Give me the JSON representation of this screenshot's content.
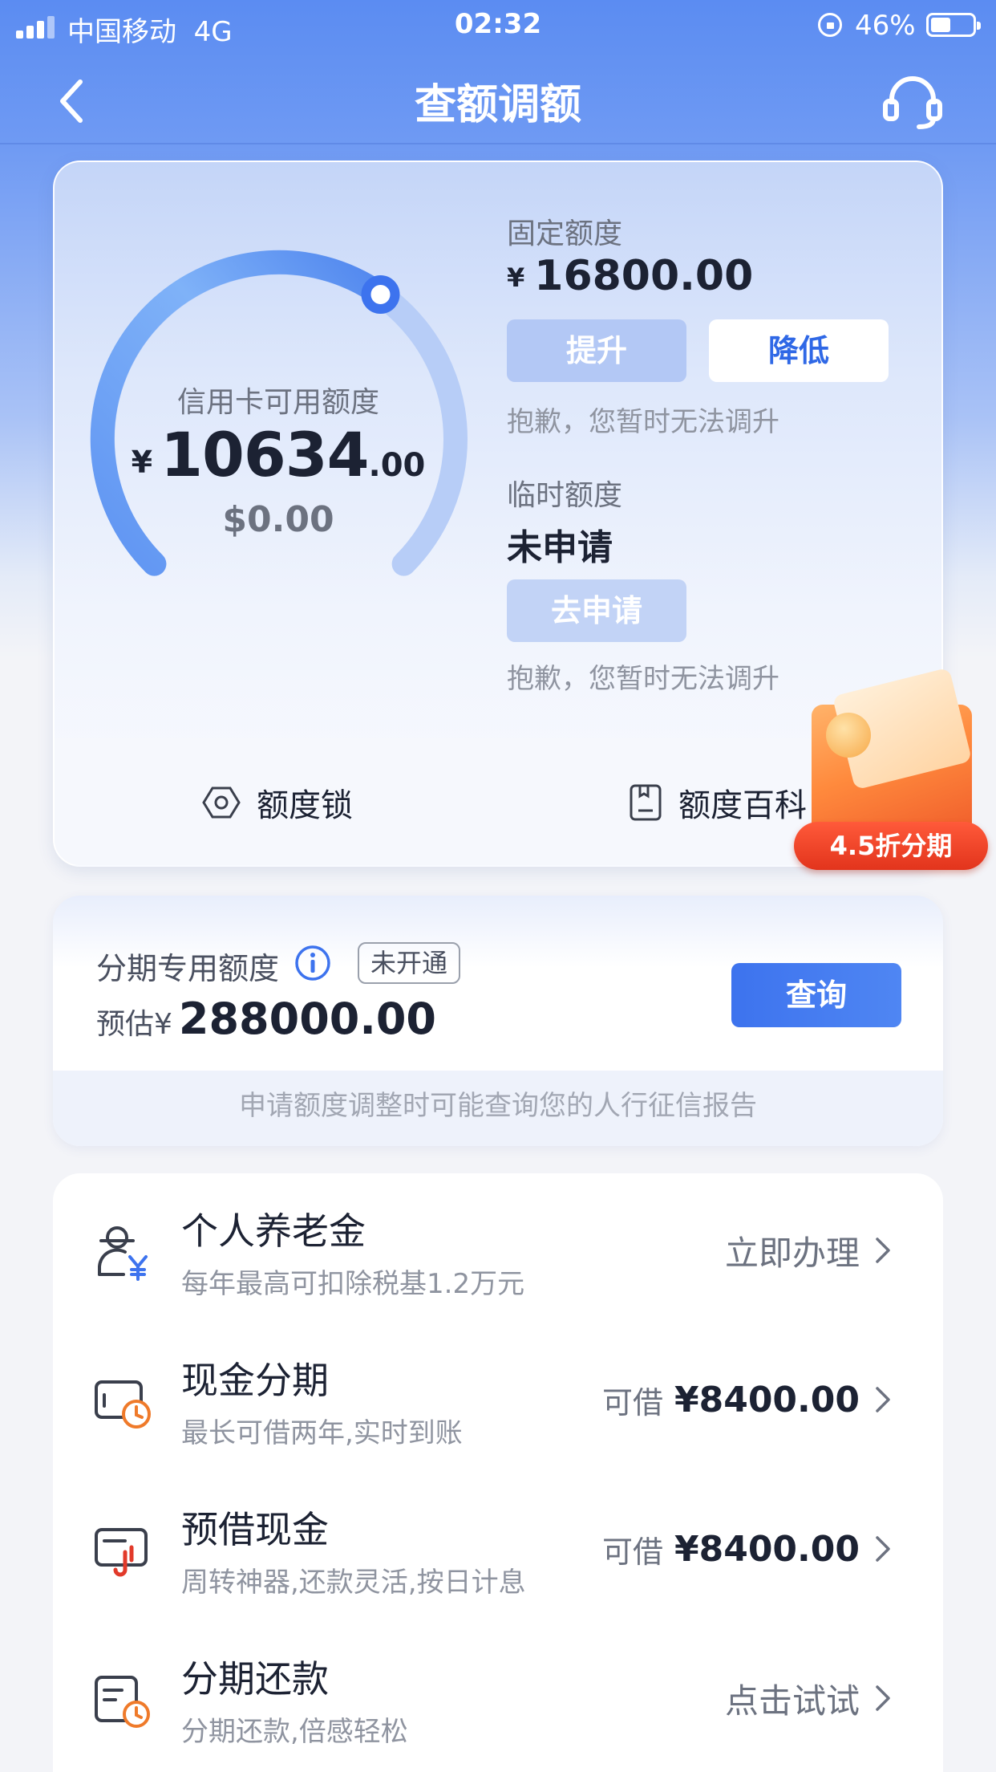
{
  "status_bar": {
    "carrier": "中国移动",
    "network": "4G",
    "time": "02:32",
    "battery": "46%"
  },
  "nav": {
    "title": "查额调额"
  },
  "credit": {
    "gauge_label": "信用卡可用额度",
    "currency": "¥",
    "available_int": "10634",
    "available_dec": ".00",
    "usd": "$0.00",
    "gauge_fraction": 0.63,
    "fixed_title": "固定额度",
    "fixed_amount": "16800.00",
    "raise_label": "提升",
    "lower_label": "降低",
    "fixed_note": "抱歉，您暂时无法调升",
    "temp_title": "临时额度",
    "temp_status": "未申请",
    "apply_label": "去申请",
    "temp_note": "抱歉，您暂时无法调升",
    "quota_lock_label": "额度锁",
    "quota_wiki_label": "额度百科"
  },
  "promo": {
    "label": "4.5折分期"
  },
  "installment": {
    "title": "分期专用额度",
    "badge": "未开通",
    "prefix": "预估¥",
    "amount": "288000.00",
    "query_label": "查询",
    "footer_note": "申请额度调整时可能查询您的人行征信报告"
  },
  "services": [
    {
      "icon": "pension-icon",
      "title": "个人养老金",
      "subtitle": "每年最高可扣除税基1.2万元",
      "action": "立即办理"
    },
    {
      "icon": "cash-installment-icon",
      "title": "现金分期",
      "subtitle": "最长可借两年,实时到账",
      "prefix": "可借",
      "amount": "¥8400.00"
    },
    {
      "icon": "cash-advance-icon",
      "title": "预借现金",
      "subtitle": "周转神器,还款灵活,按日计息",
      "prefix": "可借",
      "amount": "¥8400.00"
    },
    {
      "icon": "installment-repay-icon",
      "title": "分期还款",
      "subtitle": "分期还款,倍感轻松",
      "action": "点击试试"
    }
  ],
  "colors": {
    "primary": "#3d73ee",
    "accent_orange": "#ef5a2a",
    "gauge_start": "#6fa8f7",
    "gauge_end": "#b9cdf7"
  }
}
